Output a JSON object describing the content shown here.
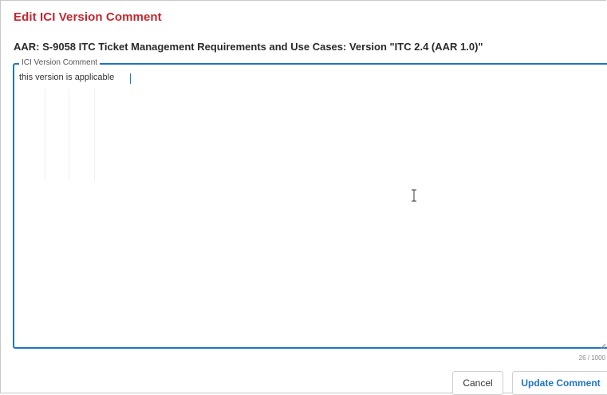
{
  "dialog": {
    "title": "Edit ICI Version Comment",
    "document_heading": "AAR: S-9058 ITC Ticket Management Requirements and Use Cases: Version \"ITC 2.4 (AAR 1.0)\""
  },
  "comment_field": {
    "label": "ICI Version Comment",
    "value": "this version is applicable",
    "counter": "26 / 1000"
  },
  "actions": {
    "cancel_label": "Cancel",
    "update_label": "Update Comment"
  },
  "colors": {
    "title": "#c4262e",
    "accent": "#1e74c6"
  },
  "icons": {
    "cursor": "text-cursor-ibeam-icon",
    "resize": "resize-grip-icon"
  }
}
